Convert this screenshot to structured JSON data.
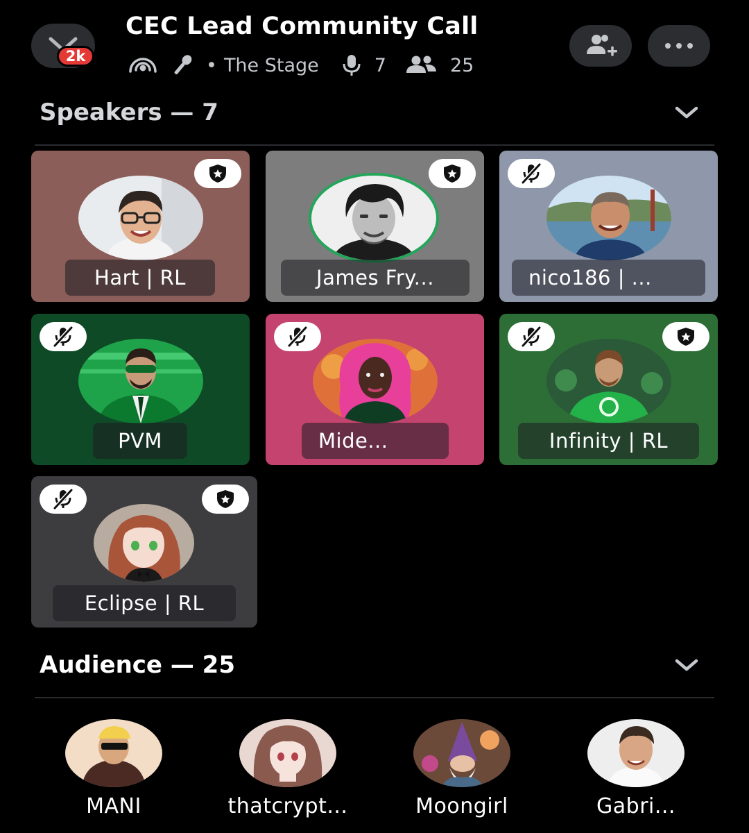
{
  "header": {
    "title": "CEC Lead Community Call",
    "notification_count": "2k",
    "stage_name": "The Stage",
    "speaker_count": "7",
    "listener_count": "25",
    "icons": [
      "back-chevron-icon",
      "stage-broadcast-icon",
      "microphone-icon",
      "people-icon",
      "add-user-icon",
      "more-icon"
    ]
  },
  "speakers": {
    "title": "Speakers — 7",
    "items": [
      {
        "name": "Hart | RL",
        "muted": false,
        "moderator": true,
        "speaking": false,
        "bg": "#8b5e5a"
      },
      {
        "name": "James Fry...",
        "muted": false,
        "moderator": true,
        "speaking": true,
        "bg": "#7d7d7d"
      },
      {
        "name": "nico186 | ...",
        "muted": true,
        "moderator": false,
        "speaking": false,
        "bg": "#8e98aa"
      },
      {
        "name": "PVM",
        "muted": true,
        "moderator": false,
        "speaking": false,
        "bg": "#0f4a27"
      },
      {
        "name": "Mide...",
        "muted": true,
        "moderator": false,
        "speaking": false,
        "bg": "#c4436f"
      },
      {
        "name": "Infinity | RL",
        "muted": true,
        "moderator": true,
        "speaking": false,
        "bg": "#2c6e36"
      },
      {
        "name": "Eclipse | RL",
        "muted": true,
        "moderator": true,
        "speaking": false,
        "bg": "#3d3d3f"
      }
    ]
  },
  "audience": {
    "title": "Audience — 25",
    "items": [
      {
        "name": "MANI"
      },
      {
        "name": "thatcrypt..."
      },
      {
        "name": "Moongirl"
      },
      {
        "name": "Gabri..."
      }
    ]
  },
  "colors": {
    "background": "#000000",
    "speaking_ring": "#23a55a",
    "badge": "#e53935",
    "button_bg": "#2b2d31"
  }
}
